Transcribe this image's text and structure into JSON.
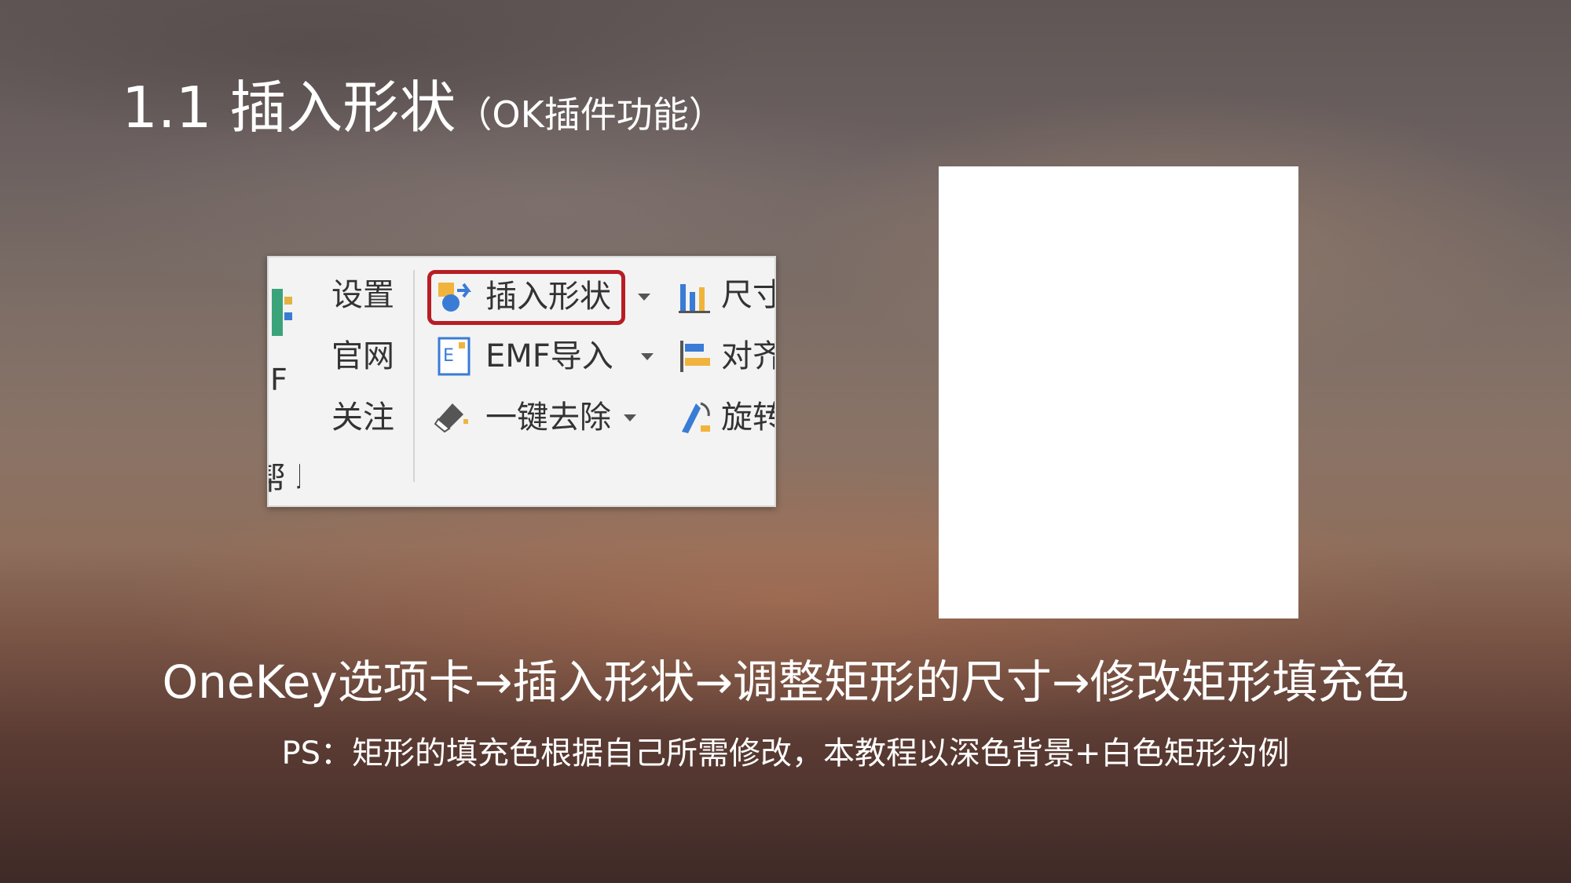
{
  "slide": {
    "title_main": "1.1 插入形状",
    "title_sub": "（OK插件功能）",
    "main_line": "OneKey选项卡→插入形状→调整矩形的尺寸→修改矩形填充色",
    "ps_line": "PS：矩形的填充色根据自己所需修改，本教程以深色背景+白色矩形为例"
  },
  "ribbon": {
    "left_partial_top": "F",
    "left_partial_bottom": "帮 助",
    "settings": "设置",
    "website": "官网",
    "follow": "关注",
    "insert_shape": "插入形状",
    "emf_import": "EMF导入",
    "one_click_remove": "一键去除",
    "size": "尺寸",
    "align": "对齐",
    "rotate": "旋转"
  },
  "icons": {
    "insert_shape": "shape-insert-icon",
    "emf_import": "emf-icon",
    "one_click_remove": "eraser-icon",
    "size": "size-icon",
    "align": "align-icon",
    "rotate": "rotate-icon"
  },
  "colors": {
    "highlight_border": "#b81d24",
    "rectangle_fill": "#ffffff"
  }
}
